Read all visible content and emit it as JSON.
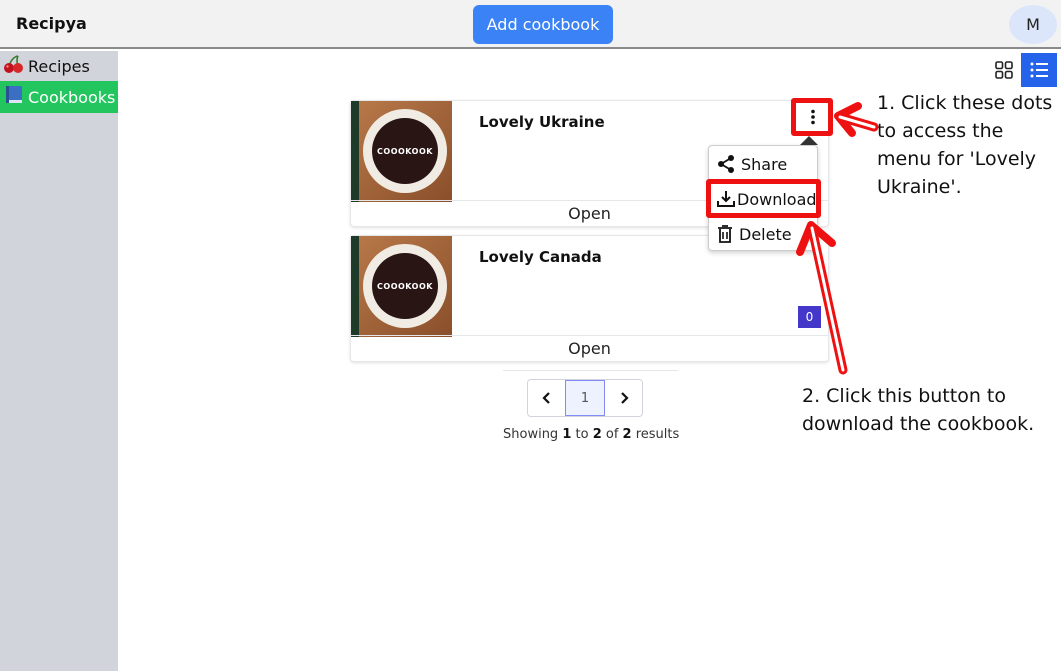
{
  "header": {
    "app_title": "Recipya",
    "add_button_label": "Add cookbook",
    "avatar_initial": "M"
  },
  "sidebar": {
    "items": [
      {
        "icon": "cherries-icon",
        "label": "Recipes",
        "active": false
      },
      {
        "icon": "book-icon",
        "label": "Cookbooks",
        "active": true
      }
    ]
  },
  "view_toggle": {
    "options": [
      "grid-view-icon",
      "list-view-icon"
    ],
    "selected": "list"
  },
  "cookbooks": [
    {
      "title": "Lovely Ukraine",
      "cover_text": "COOOKOOK",
      "open_label": "Open",
      "count": ""
    },
    {
      "title": "Lovely Canada",
      "cover_text": "COOOKOOK",
      "open_label": "Open",
      "count": "0"
    }
  ],
  "menu": {
    "items": [
      {
        "icon": "share-icon",
        "label": "Share"
      },
      {
        "icon": "download-icon",
        "label": "Download"
      },
      {
        "icon": "trash-icon",
        "label": "Delete"
      }
    ]
  },
  "pagination": {
    "current_page": "1",
    "info_prefix": "Showing ",
    "from": "1",
    "info_to": " to ",
    "to": "2",
    "info_of": " of ",
    "total": "2",
    "info_suffix": " results"
  },
  "annotations": {
    "step1": "1. Click these dots to access the menu for 'Lovely Ukraine'.",
    "step2": "2. Click this button to download the cookbook."
  },
  "colors": {
    "primary": "#3b82f6",
    "sidebar_active": "#22c55e",
    "highlight": "#ee1111",
    "badge": "#4338ca"
  }
}
